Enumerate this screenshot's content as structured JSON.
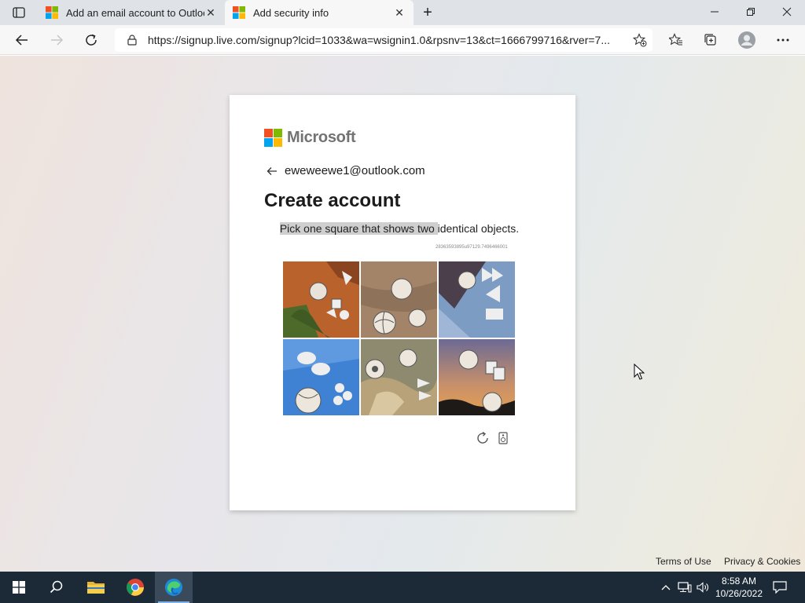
{
  "browser": {
    "tabs": [
      {
        "title": "Add an email account to Outlook",
        "active": false
      },
      {
        "title": "Add security info",
        "active": true
      }
    ],
    "url": "https://signup.live.com/signup?lcid=1033&wa=wsignin1.0&rpsnv=13&ct=1666799716&rver=7..."
  },
  "card": {
    "brand": "Microsoft",
    "identity": "eweweewe1@outlook.com",
    "heading": "Create account",
    "captcha": {
      "instruction_highlight": "Pick one square that shows two ",
      "instruction_rest": "identical objects.",
      "challenge_id": "28363593895u97129.7496466001"
    }
  },
  "footer": {
    "terms": "Terms of Use",
    "privacy": "Privacy & Cookies"
  },
  "taskbar": {
    "time": "8:58 AM",
    "date": "10/26/2022"
  },
  "colors": {
    "ms_red": "#f25022",
    "ms_green": "#7fba00",
    "ms_blue": "#00a4ef",
    "ms_yellow": "#ffb900",
    "taskbar": "#1c2a38"
  }
}
